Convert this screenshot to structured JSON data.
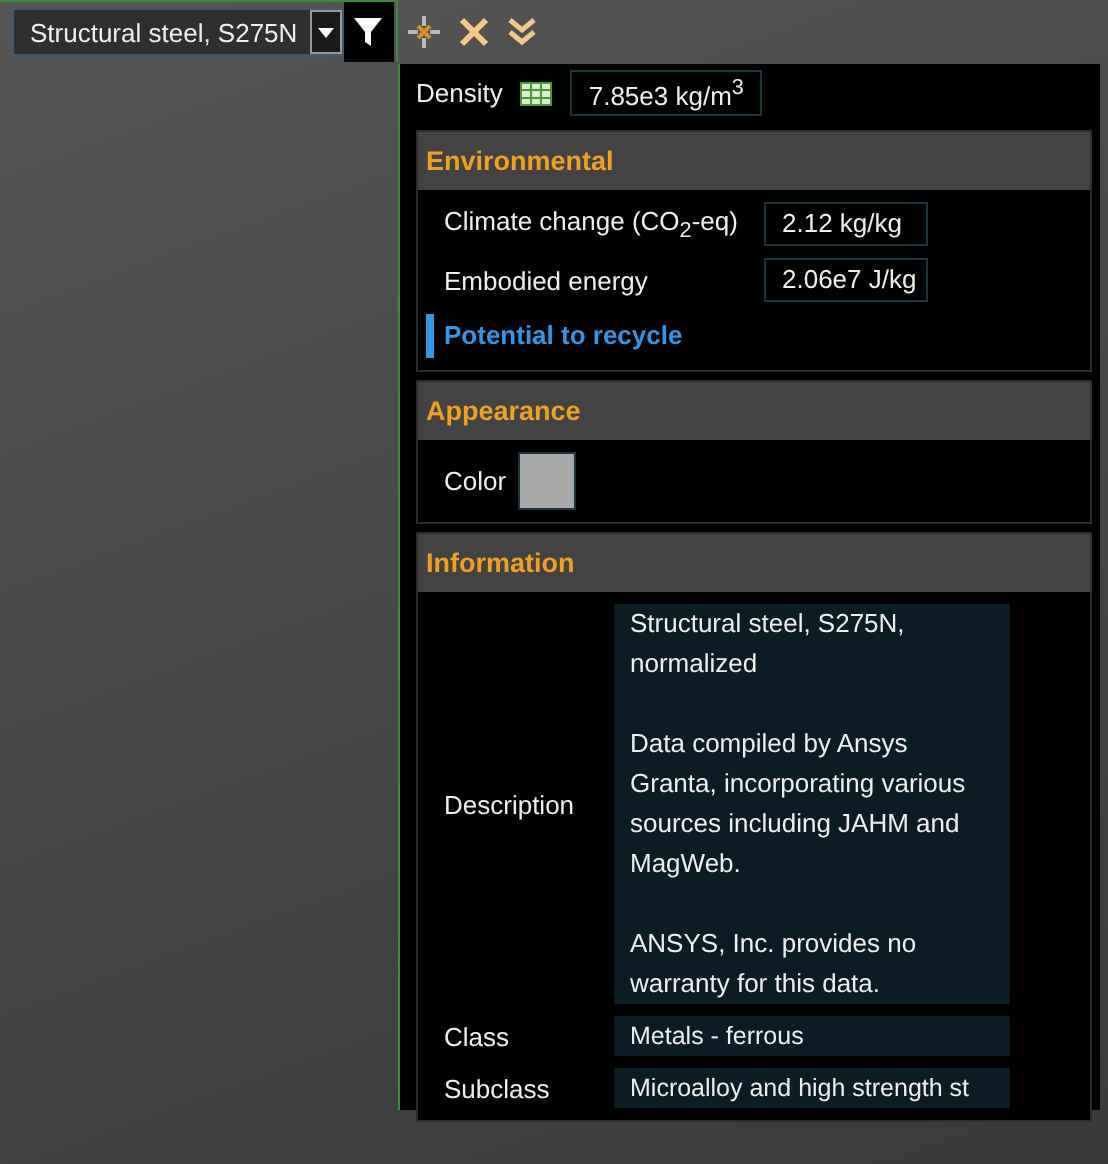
{
  "selector": {
    "value": "Structural steel, S275N"
  },
  "density": {
    "label": "Density",
    "value": "7.85e3 kg/m$^{3}$"
  },
  "sections": [
    {
      "title": "Environmental",
      "rows": [
        {
          "kind": "field",
          "label": "Climate change (CO$_{2}$-eq)",
          "value": "2.12 kg/kg"
        },
        {
          "kind": "field",
          "label": "Embodied energy",
          "value": "2.06e7 J/kg"
        },
        {
          "kind": "link",
          "label": "Potential to recycle"
        }
      ]
    },
    {
      "title": "Appearance",
      "rows": [
        {
          "kind": "swatch",
          "label": "Color",
          "color": "#a9a9a9"
        }
      ]
    },
    {
      "title": "Information",
      "rows": [
        {
          "kind": "text",
          "label": "Description",
          "paragraphs": [
            "Structural steel, S275N, normalized",
            "Data compiled by Ansys Granta, incorporating various sources including JAHM and MagWeb.",
            "ANSYS, Inc. provides no warranty for this data."
          ]
        },
        {
          "kind": "text",
          "label": "Class",
          "paragraphs": [
            "Metals - ferrous"
          ]
        },
        {
          "kind": "text",
          "label": "Subclass",
          "paragraphs": [
            "Microalloy and high strength st"
          ]
        }
      ]
    }
  ]
}
